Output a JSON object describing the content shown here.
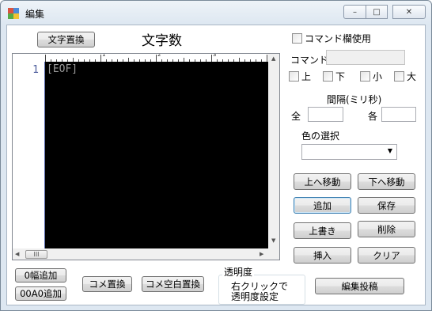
{
  "window": {
    "title": "編集",
    "controls": {
      "minimize": "–",
      "maximize": "□",
      "close": "✕"
    }
  },
  "toolbar": {
    "replace_text_button": "文字置換",
    "char_count_label": "文字数"
  },
  "editor": {
    "line_number": "1",
    "content": "[EOF]",
    "ruler_numbers": [
      "1",
      "2",
      "3"
    ],
    "hscroll_thumb": "III"
  },
  "command": {
    "use_checkbox_label": "コマンド欄使用",
    "command_label": "コマンド",
    "command_value": "",
    "positions": [
      "上",
      "下",
      "小",
      "大"
    ]
  },
  "interval": {
    "title": "間隔(ミリ秒)",
    "all_label": "全",
    "each_label": "各",
    "all_value": "",
    "each_value": ""
  },
  "color": {
    "title": "色の選択",
    "selected": ""
  },
  "buttons": {
    "move_up": "上へ移動",
    "move_down": "下へ移動",
    "add": "追加",
    "save": "保存",
    "overwrite": "上書き",
    "delete": "削除",
    "insert": "挿入",
    "clear": "クリア",
    "edit_post": "編集投稿"
  },
  "bottom": {
    "zero_width_add": "0幅追加",
    "a0_add": "00A0追加",
    "comment_replace": "コメ置換",
    "comment_space_replace": "コメ空白置換"
  },
  "transparency": {
    "title": "透明度",
    "hint_line1": "右クリックで",
    "hint_line2": "透明度設定"
  }
}
